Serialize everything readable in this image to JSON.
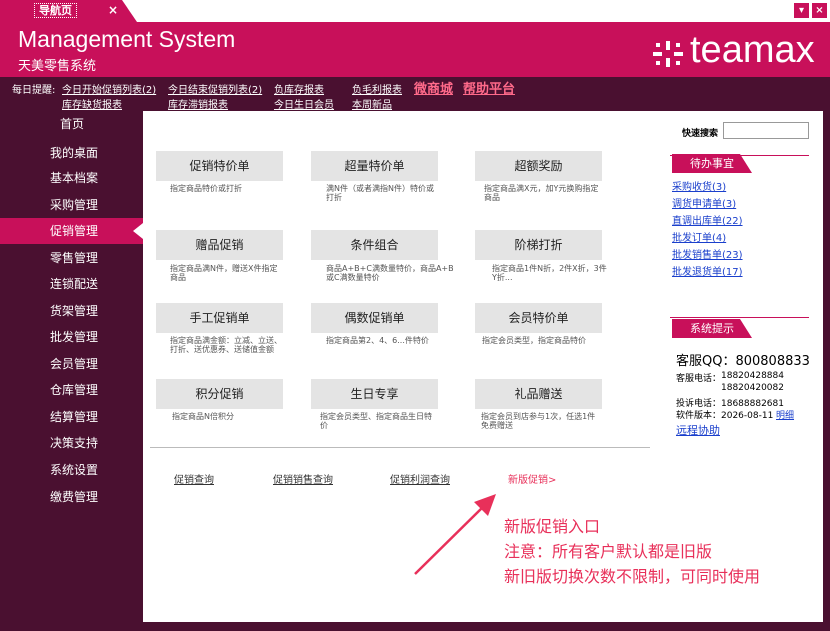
{
  "tab": {
    "label": "导航页",
    "close": "×"
  },
  "window": {
    "min": "▾",
    "close": "×"
  },
  "header": {
    "title": "Management System",
    "subtitle": "天美零售系统",
    "logo": "teamax",
    "logo_icon": "snowflake-icon"
  },
  "reminder": {
    "label": "每日提醒:",
    "row1": [
      "今日开始促销列表(2)",
      "今日结束促销列表(2)",
      "负库存报表",
      "负毛利报表"
    ],
    "row2": [
      "库存缺货报表",
      "库存滞销报表",
      "今日生日会员",
      "本周新品"
    ],
    "big_links": [
      "微商城",
      "帮助平台"
    ]
  },
  "sidebar": {
    "items": [
      {
        "label": "首页"
      },
      {
        "label": "我的桌面"
      },
      {
        "label": "基本档案"
      },
      {
        "label": "采购管理"
      },
      {
        "label": "促销管理"
      },
      {
        "label": "零售管理"
      },
      {
        "label": "连锁配送"
      },
      {
        "label": "货架管理"
      },
      {
        "label": "批发管理"
      },
      {
        "label": "会员管理"
      },
      {
        "label": "仓库管理"
      },
      {
        "label": "结算管理"
      },
      {
        "label": "决策支持"
      },
      {
        "label": "系统设置"
      },
      {
        "label": "缴费管理"
      }
    ],
    "active": "促销管理"
  },
  "search": {
    "label": "快速搜索",
    "value": ""
  },
  "cards": [
    {
      "title": "促销特价单",
      "desc": "指定商品特价或打折"
    },
    {
      "title": "超量特价单",
      "desc": "满N件（或者满指N件）特价或打折"
    },
    {
      "title": "超额奖励",
      "desc": "指定商品满X元，加Y元换购指定商品"
    },
    {
      "title": "赠品促销",
      "desc": "指定商品满N件，赠送X件指定商品"
    },
    {
      "title": "条件组合",
      "desc": "商品A+B+C满数量特价，商品A+B或C满数量特价"
    },
    {
      "title": "阶梯打折",
      "desc": "指定商品1件N折，2件X折，3件Y折..."
    },
    {
      "title": "手工促销单",
      "desc": "指定商品满金额：立减、立送、打折、送优惠券、送储值金额"
    },
    {
      "title": "偶数促销单",
      "desc": "指定商品第2、4、6...件特价"
    },
    {
      "title": "会员特价单",
      "desc": "指定会员类型，指定商品特价"
    },
    {
      "title": "积分促销",
      "desc": "指定商品N倍积分"
    },
    {
      "title": "生日专享",
      "desc": "指定会员类型、指定商品生日特价"
    },
    {
      "title": "礼品赠送",
      "desc": "指定会员到店参与1次，任选1件免费赠送"
    }
  ],
  "bottom_links": [
    "促销查询",
    "促销销售查询",
    "促销利润查询",
    "新版促销>"
  ],
  "annotation": {
    "line1": "新版促销入口",
    "line2": "注意：所有客户默认都是旧版",
    "line3": "新旧版切换次数不限制，可同时使用"
  },
  "todo": {
    "title": "待办事宜",
    "items": [
      "采购收货(3)",
      "调货申请单(3)",
      "直调出库单(22)",
      "批发订单(4)",
      "批发销售单(23)",
      "批发退货单(17)"
    ]
  },
  "tips": {
    "title": "系统提示",
    "qq": "客服QQ：800808833",
    "phone_label": "客服电话：",
    "phone1": "18820428884",
    "phone2": "18820420082",
    "complaint": "投诉电话：18688882681",
    "version": "软件版本：2026-08-11",
    "version_link": "明细",
    "remote": "远程协助"
  },
  "colors": {
    "brand": "#c8105a",
    "dark": "#4a1030",
    "annotation": "#e8305a"
  }
}
